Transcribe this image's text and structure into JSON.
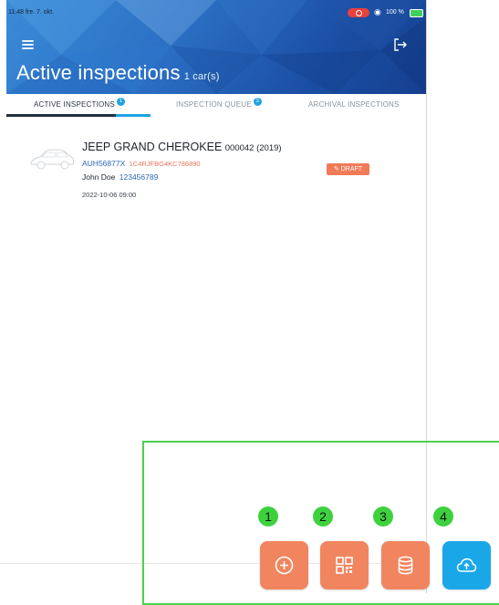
{
  "status_bar": {
    "time_date": "11.48  fre. 7. okt.",
    "battery_percent": "100 %"
  },
  "header": {
    "title": "Active inspections",
    "count": "1 car(s)"
  },
  "tabs": [
    {
      "label": "ACTIVE INSPECTIONS",
      "badge": "1"
    },
    {
      "label": "INSPECTION QUEUE",
      "badge": "3"
    },
    {
      "label": "ARCHIVAL INSPECTIONS"
    }
  ],
  "inspection": {
    "vehicle": "JEEP GRAND CHEROKEE",
    "sub": "000042 (2019)",
    "plate": "AUH56877X",
    "vin": "1C4RJFBG4KC786890",
    "owner": "John Doe",
    "phone": "123456789",
    "date": "2022-10-06 09:00",
    "status": "DRAFT"
  },
  "actions": [
    {
      "number": "1",
      "icon": "add-circle-icon"
    },
    {
      "number": "2",
      "icon": "qr-code-icon"
    },
    {
      "number": "3",
      "icon": "database-icon"
    },
    {
      "number": "4",
      "icon": "cloud-upload-icon"
    }
  ],
  "colors": {
    "orange": "#f1855f",
    "blue": "#1aa7e8",
    "highlight": "#4bd14b"
  }
}
